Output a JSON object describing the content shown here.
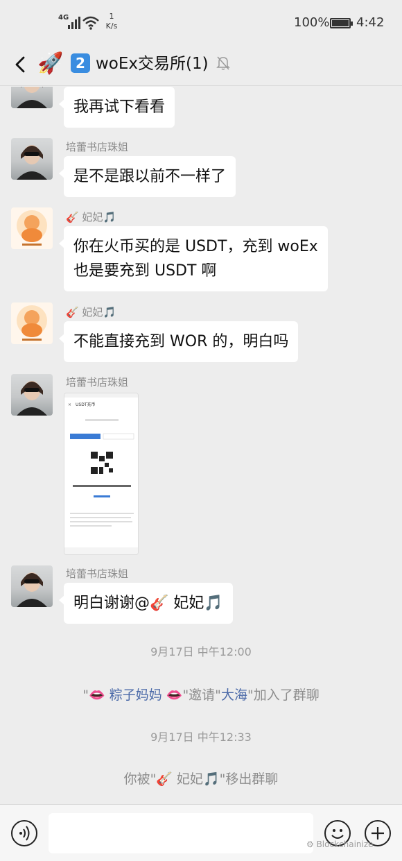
{
  "status_bar": {
    "network_type": "4G",
    "speed_value": "1",
    "speed_unit": "K/s",
    "battery_percent": "100%",
    "battery_level": 1.0,
    "time": "4:42"
  },
  "header": {
    "group_emoji": "🚀",
    "badge": "2",
    "title": "woEx交易所(1)",
    "muted": true
  },
  "messages": [
    {
      "sender": "",
      "text": "我再试下看看"
    },
    {
      "sender": "培蕾书店珠姐",
      "text": "是不是跟以前不一样了"
    },
    {
      "sender": "🎸 妃妃🎵",
      "line1": "你在火币买的是 USDT，充到 woEx",
      "line2": "也是要充到 USDT 啊"
    },
    {
      "sender": "🎸 妃妃🎵",
      "text": "不能直接充到 WOR 的，明白吗"
    },
    {
      "sender": "培蕾书店珠姐",
      "image_caption": "USDT充币"
    },
    {
      "sender": "培蕾书店珠姐",
      "text": "明白谢谢@🎸 妃妃🎵"
    }
  ],
  "system": {
    "time1": "9月17日 中午12:00",
    "invite": {
      "prefix": "\"👄 ",
      "inviter": "粽子妈妈",
      "middle": " 👄\"邀请\"",
      "invitee": "大海",
      "suffix": "\"加入了群聊"
    },
    "time2": "9月17日 中午12:33",
    "removed": "你被\"🎸 妃妃🎵\"移出群聊"
  },
  "input": {
    "value": "",
    "placeholder": ""
  },
  "watermark": "Blockchainize",
  "colors": {
    "background": "#ededed",
    "bubble": "#ffffff",
    "system_name": "#4a69a8",
    "badge": "#3a8de0"
  }
}
